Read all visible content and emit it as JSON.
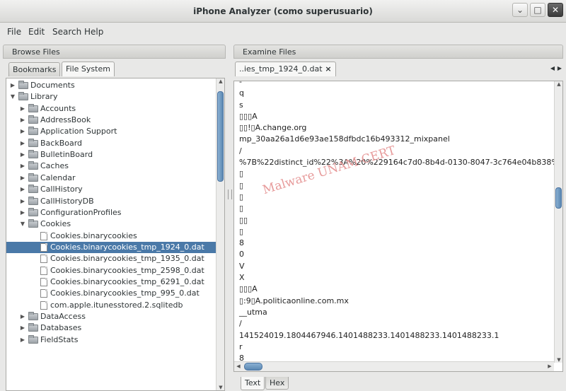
{
  "window": {
    "title": "iPhone Analyzer (como superusuario)",
    "minimize_glyph": "⌄",
    "maximize_glyph": "□",
    "close_glyph": "✕"
  },
  "menu": [
    "File",
    "Edit",
    "Search",
    "Help"
  ],
  "browse": {
    "header": "Browse Files",
    "tabs": [
      "Bookmarks",
      "File System"
    ],
    "active_tab": "File System",
    "tree": [
      {
        "label": "Documents",
        "type": "folder",
        "depth": 0,
        "expanded": false
      },
      {
        "label": "Library",
        "type": "folder",
        "depth": 0,
        "expanded": true
      },
      {
        "label": "Accounts",
        "type": "folder",
        "depth": 1,
        "expanded": false
      },
      {
        "label": "AddressBook",
        "type": "folder",
        "depth": 1,
        "expanded": false
      },
      {
        "label": "Application Support",
        "type": "folder",
        "depth": 1,
        "expanded": false
      },
      {
        "label": "BackBoard",
        "type": "folder",
        "depth": 1,
        "expanded": false
      },
      {
        "label": "BulletinBoard",
        "type": "folder",
        "depth": 1,
        "expanded": false
      },
      {
        "label": "Caches",
        "type": "folder",
        "depth": 1,
        "expanded": false
      },
      {
        "label": "Calendar",
        "type": "folder",
        "depth": 1,
        "expanded": false
      },
      {
        "label": "CallHistory",
        "type": "folder",
        "depth": 1,
        "expanded": false
      },
      {
        "label": "CallHistoryDB",
        "type": "folder",
        "depth": 1,
        "expanded": false
      },
      {
        "label": "ConfigurationProfiles",
        "type": "folder",
        "depth": 1,
        "expanded": false
      },
      {
        "label": "Cookies",
        "type": "folder",
        "depth": 1,
        "expanded": true
      },
      {
        "label": "Cookies.binarycookies",
        "type": "file",
        "depth": 2
      },
      {
        "label": "Cookies.binarycookies_tmp_1924_0.dat",
        "type": "file",
        "depth": 2,
        "selected": true
      },
      {
        "label": "Cookies.binarycookies_tmp_1935_0.dat",
        "type": "file",
        "depth": 2
      },
      {
        "label": "Cookies.binarycookies_tmp_2598_0.dat",
        "type": "file",
        "depth": 2
      },
      {
        "label": "Cookies.binarycookies_tmp_6291_0.dat",
        "type": "file",
        "depth": 2
      },
      {
        "label": "Cookies.binarycookies_tmp_995_0.dat",
        "type": "file",
        "depth": 2
      },
      {
        "label": "com.apple.itunesstored.2.sqlitedb",
        "type": "file",
        "depth": 2
      },
      {
        "label": "DataAccess",
        "type": "folder",
        "depth": 1,
        "expanded": false
      },
      {
        "label": "Databases",
        "type": "folder",
        "depth": 1,
        "expanded": false
      },
      {
        "label": "FieldStats",
        "type": "folder",
        "depth": 1,
        "expanded": false
      }
    ]
  },
  "examine": {
    "header": "Examine Files",
    "file_tab": "..ies_tmp_1924_0.dat",
    "tab_close": "×",
    "lines": [
      "-",
      "q",
      "s",
      "▯▯▯A",
      "▯▯!▯A.change.org",
      "mp_30aa26a1d6e93ae158dfbdc16b493312_mixpanel",
      "/",
      "%7B%22distinct_id%22%3A%20%229164c7d0-8b4d-0130-8047-3c764e04b838%22",
      "▯",
      "▯",
      "▯",
      "▯",
      "▯▯",
      "▯",
      "8",
      "0",
      "V",
      "X",
      "▯▯▯A",
      "▯:9▯A.politicaonline.com.mx",
      "__utma",
      "/",
      "141524019.1804467946.1401488233.1401488233.1401488233.1",
      "r",
      "8",
      "0",
      "V"
    ],
    "watermark": "Malware UNAM-CERT",
    "view_tabs": [
      "Text",
      "Hex"
    ],
    "active_view": "Text"
  }
}
